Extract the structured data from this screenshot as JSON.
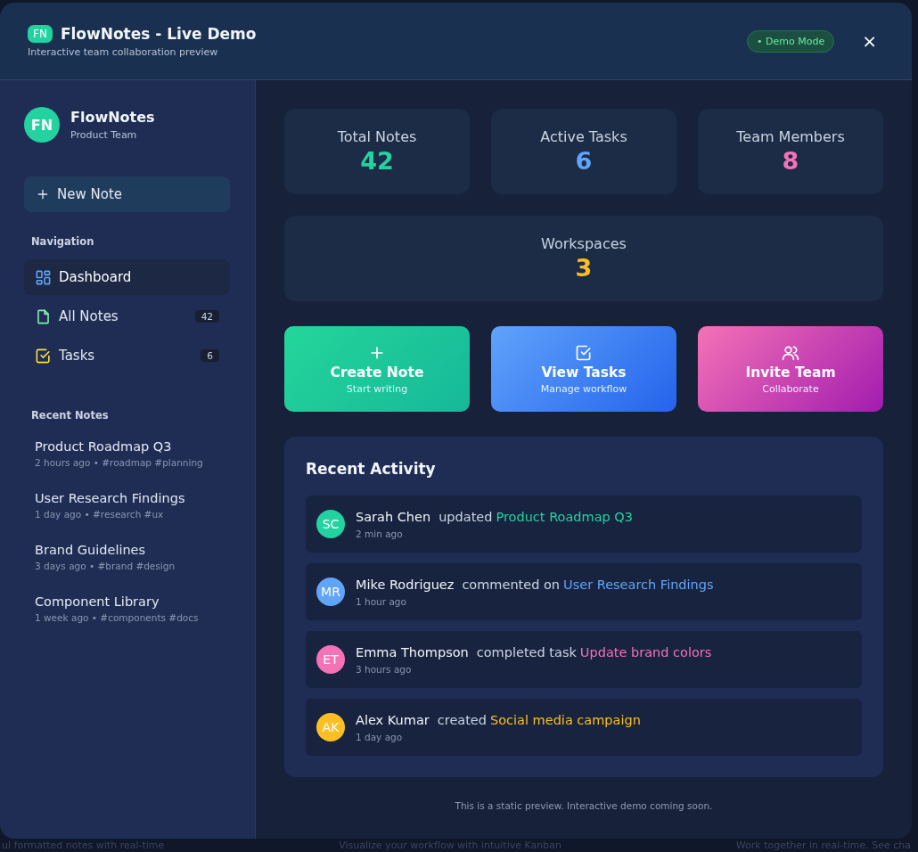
{
  "header": {
    "logo": "FN",
    "title": "FlowNotes - Live Demo",
    "subtitle": "Interactive team collaboration preview",
    "badge": "• Demo Mode",
    "close": "×"
  },
  "sidebar": {
    "avatar": "FN",
    "name": "FlowNotes",
    "team": "Product Team",
    "new_note": "New Note",
    "navigation_heading": "Navigation",
    "nav_items": [
      {
        "kind": "grid",
        "label": "Dashboard",
        "selected": true
      },
      {
        "kind": "file",
        "label": "All Notes",
        "count": "42",
        "selected": false
      },
      {
        "kind": "check",
        "label": "Tasks",
        "count": "6",
        "selected": false
      }
    ],
    "recent_heading": "Recent Notes",
    "recent_notes": [
      {
        "title": "Product Roadmap Q3",
        "meta": "2 hours ago • #roadmap #planning"
      },
      {
        "title": "User Research Findings",
        "meta": "1 day ago • #research #ux"
      },
      {
        "title": "Brand Guidelines",
        "meta": "3 days ago • #brand #design"
      },
      {
        "title": "Component Library",
        "meta": "1 week ago • #components #docs"
      }
    ]
  },
  "stats": [
    {
      "label": "Total Notes",
      "value": "42",
      "color": "#22d3a0"
    },
    {
      "label": "Active Tasks",
      "value": "6",
      "color": "#60a5fa"
    },
    {
      "label": "Team Members",
      "value": "8",
      "color": "#f472b6"
    },
    {
      "label": "Workspaces",
      "value": "3",
      "color": "#fbbf24"
    }
  ],
  "actions": [
    {
      "kind": "plus",
      "title": "Create Note",
      "subtitle": "Start writing"
    },
    {
      "kind": "check",
      "title": "View Tasks",
      "subtitle": "Manage workflow"
    },
    {
      "kind": "users",
      "title": "Invite Team",
      "subtitle": "Collaborate"
    }
  ],
  "activity": {
    "title": "Recent Activity",
    "items": [
      {
        "initials": "SC",
        "color": "#22d3a0",
        "name": "Sarah Chen",
        "action": "updated",
        "target": "Product Roadmap Q3",
        "time": "2 min ago"
      },
      {
        "initials": "MR",
        "color": "#60a5fa",
        "name": "Mike Rodriguez",
        "action": "commented on",
        "target": "User Research Findings",
        "time": "1 hour ago"
      },
      {
        "initials": "ET",
        "color": "#f472b6",
        "name": "Emma Thompson",
        "action": "completed task",
        "target": "Update brand colors",
        "time": "3 hours ago"
      },
      {
        "initials": "AK",
        "color": "#fbbf24",
        "name": "Alex Kumar",
        "action": "created",
        "target": "Social media campaign",
        "time": "1 day ago"
      }
    ]
  },
  "footer_note": "This is a static preview. Interactive demo coming soon.",
  "background_texts": [
    "ul formatted notes with real-time",
    "Visualize your workflow with intuitive Kanban",
    "Work together in real-time. See cha"
  ]
}
